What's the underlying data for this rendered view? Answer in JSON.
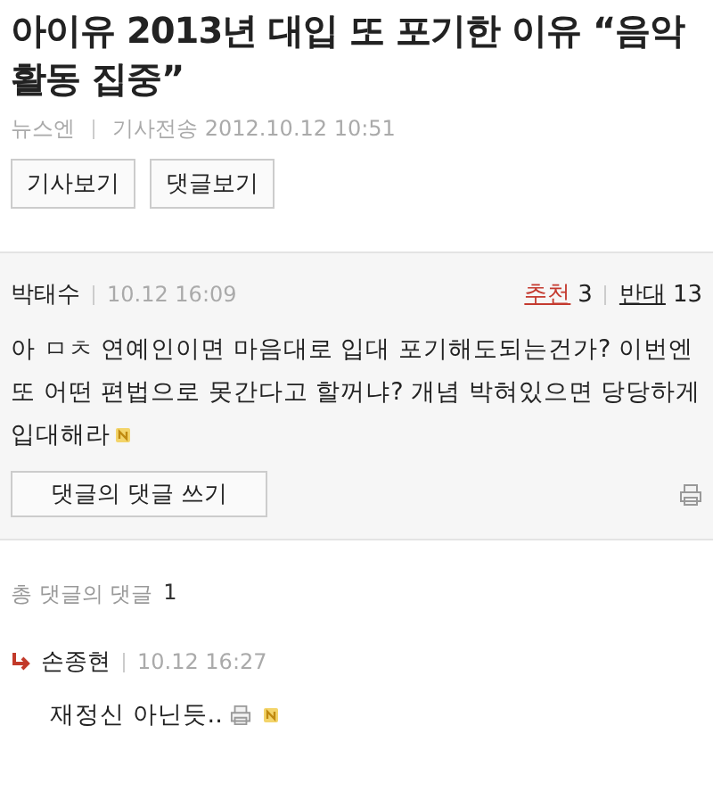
{
  "article": {
    "title": "아이유 2013년 대입 또 포기한 이유 “음악 활동 집중”",
    "source": "뉴스엔",
    "sent": "기사전송 2012.10.12 10:51",
    "buttons": [
      "기사보기",
      "댓글보기"
    ]
  },
  "comment": {
    "author": "박태수",
    "time": "10.12 16:09",
    "recommend_label": "추천",
    "recommend_count": "3",
    "oppose_label": "반대",
    "oppose_count": "13",
    "text": "아 ㅁㅊ 연예인이면 마음대로 입대 포기해도되는건가? 이번엔 또 어떤 편법으로 못간다고 할꺼냐? 개념 박혀있으면 당당하게 입대해라",
    "is_new": true,
    "reply_button": "댓글의 댓글 쓰기"
  },
  "replies_total": {
    "label": "총 댓글의 댓글",
    "count": "1"
  },
  "replies": [
    {
      "author": "손종현",
      "time": "10.12 16:27",
      "text": "재정신 아닌듯..",
      "is_new": true
    }
  ]
}
